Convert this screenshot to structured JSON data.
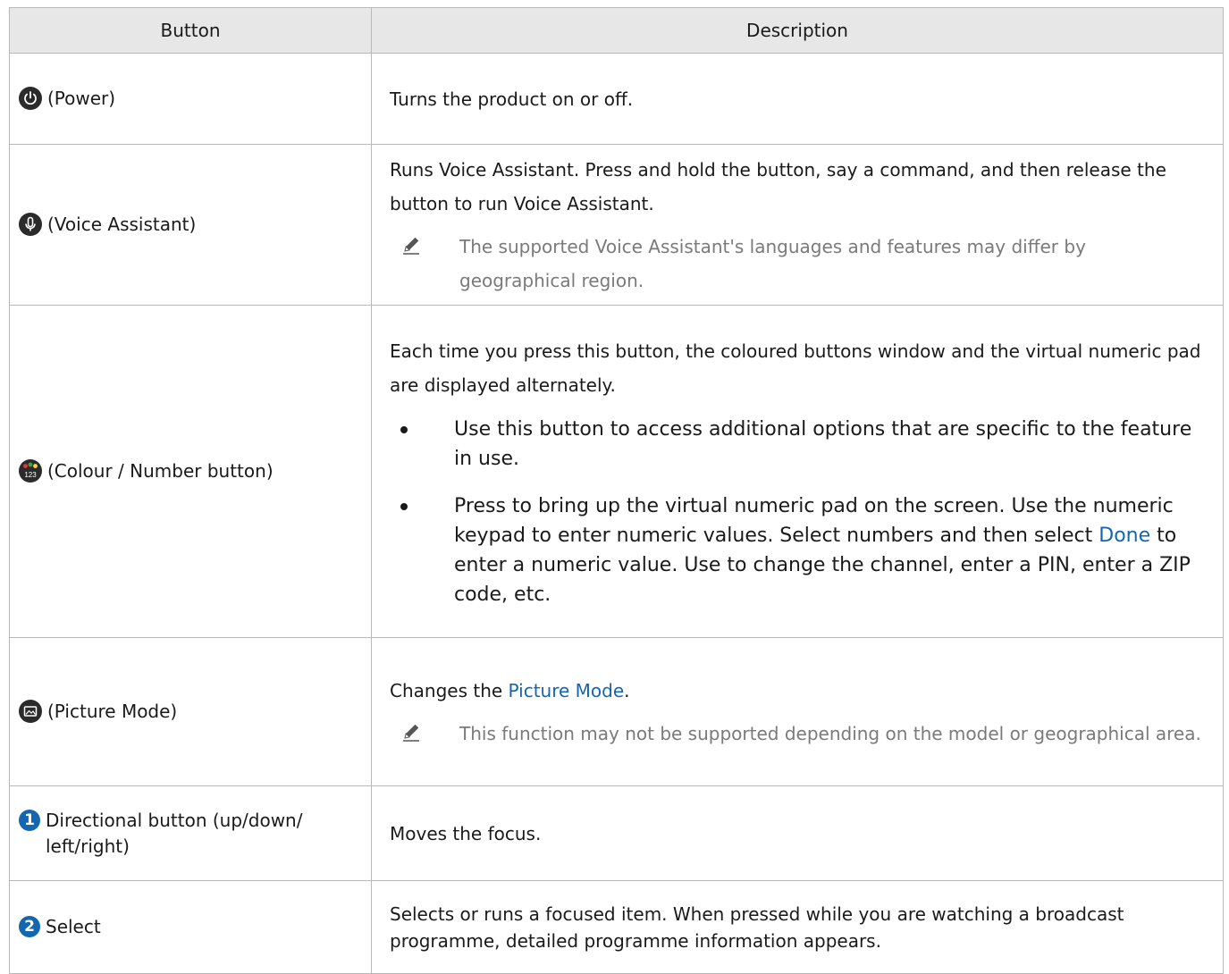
{
  "table": {
    "headers": {
      "button": "Button",
      "description": "Description"
    },
    "rows": [
      {
        "icon": "power-icon",
        "button": "(Power)",
        "description": "Turns the product on or off."
      },
      {
        "icon": "microphone-icon",
        "button": "(Voice Assistant)",
        "description": "Runs Voice Assistant. Press and hold the button, say a command, and then release the button to run Voice Assistant.",
        "note": "The supported Voice Assistant's languages and features may differ by geographical region."
      },
      {
        "icon": "colour-number-icon",
        "button": "(Colour / Number button)",
        "description": "Each time you press this button, the coloured buttons window and the virtual numeric pad are displayed alternately.",
        "bullets": {
          "b1": "Use this button to access additional options that are specific to the feature in use.",
          "b2_part1": "Press to bring up the virtual numeric pad on the screen. Use the numeric keypad to enter numeric values. Select numbers and then select ",
          "b2_link": "Done",
          "b2_part2": " to enter a numeric value. Use to change the channel, enter a PIN, enter a ZIP code, etc."
        }
      },
      {
        "icon": "picture-mode-icon",
        "button": "(Picture Mode)",
        "description_part1": "Changes the ",
        "description_link": "Picture Mode",
        "description_part2": ".",
        "note": "This function may not be supported depending on the model or geographical area."
      },
      {
        "badge": "1",
        "button": "Directional button (up/down/ left/right)",
        "description": "Moves the focus."
      },
      {
        "badge": "2",
        "button": "Select",
        "description": "Selects or runs a focused item. When pressed while you are watching a broadcast programme, detailed programme information appears."
      }
    ]
  },
  "colors": {
    "header_bg": "#e7e7e7",
    "border": "#b9b9b9",
    "highlight": "#1466b0",
    "note_text": "#7a7a7a",
    "icon_bg": "#2b2b2b"
  }
}
